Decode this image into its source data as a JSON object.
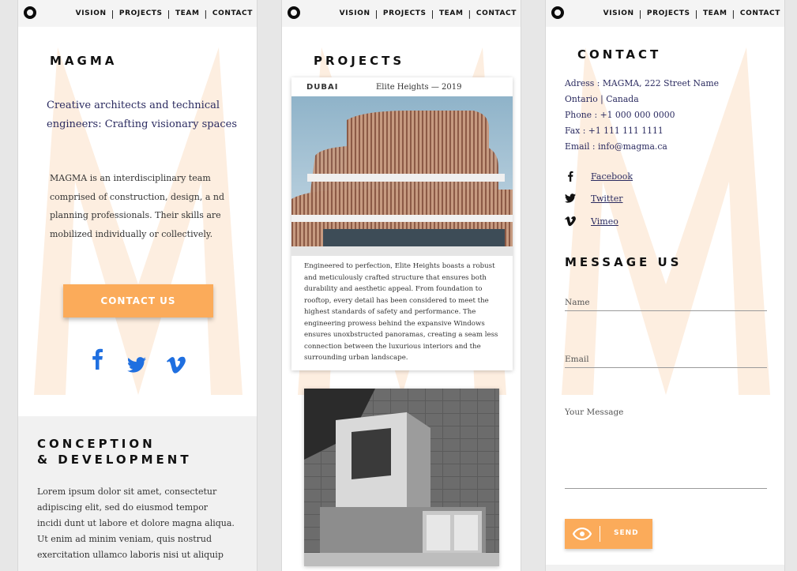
{
  "nav": {
    "vision": "VISION",
    "projects": "PROJECTS",
    "team": "TEAM",
    "contact": "CONTACT",
    "separator": "|"
  },
  "home": {
    "brand": "MAGMA",
    "tagline": "Creative architects and technical engineers: Crafting visionary spaces",
    "description": "MAGMA is an interdisciplinary team comprised of construction, design, a nd planning professionals. Their skills are mobilized individually or collectively.",
    "cta_label": "CONTACT US",
    "section_title_line1": "CONCEPTION",
    "section_title_line2": "& DEVELOPMENT",
    "lorem": "Lorem ipsum dolor sit amet, consectetur adipiscing elit, sed do eiusmod tempor incidi dunt ut labore et dolore magna aliqua. Ut enim ad minim veniam, quis nostrud exercitation ullamco laboris nisi ut aliquip"
  },
  "projects": {
    "title": "PROJECTS",
    "featured": {
      "city": "DUBAI",
      "name": "Elite Heights — 2019",
      "description": "Engineered to perfection, Elite Heights boasts a robust and meticulously crafted structure that ensures both durability and aesthetic appeal. From foundation to rooftop, every detail has been considered to meet the highest standards of safety and performance. The engineering prowess behind the expansive Windows ensures unoxbstructed panoramas, creating a seam less connection between the luxurious interiors and the surrounding urban landscape."
    }
  },
  "contact": {
    "title": "CONTACT",
    "address_line1": "Adress : MAGMA, 222 Street Name",
    "address_line2": "Ontario | Canada",
    "phone": "Phone : +1 000 000 0000",
    "fax": "Fax : +1 111 111 1111",
    "email": "Email : info@magma.ca",
    "social": {
      "facebook": "Facebook",
      "twitter": "Twitter",
      "vimeo": "Vimeo"
    },
    "message_title": "MESSAGE US",
    "form": {
      "name_placeholder": "Name",
      "email_placeholder": "Email",
      "message_placeholder": "Your Message",
      "send_label": "SEND"
    }
  },
  "colors": {
    "accent": "#fbab5a",
    "social_blue": "#1f6fe0",
    "watermark": "#fdeee0"
  }
}
